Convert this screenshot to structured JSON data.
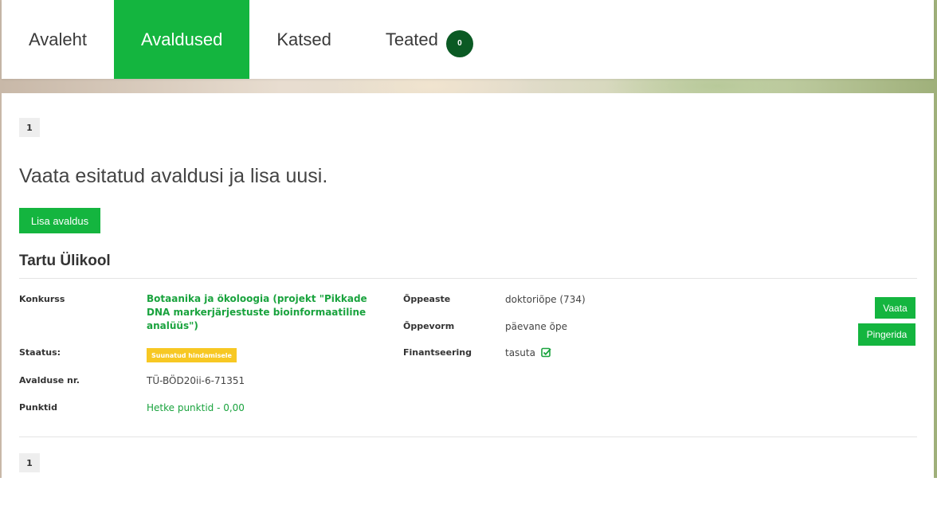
{
  "nav": {
    "items": [
      {
        "label": "Avaleht",
        "active": false
      },
      {
        "label": "Avaldused",
        "active": true
      },
      {
        "label": "Katsed",
        "active": false
      },
      {
        "label": "Teated",
        "active": false
      }
    ],
    "notifications_count": "0"
  },
  "pagination": {
    "top_page": "1",
    "bottom_page": "1"
  },
  "main": {
    "heading": "Vaata esitatud avaldusi ja lisa uusi.",
    "add_button": "Lisa avaldus",
    "school": "Tartu Ülikool"
  },
  "application": {
    "contest_label": "Konkurss",
    "contest_value": "Botaanika ja ökoloogia (projekt \"Pikkade DNA markerjärjestuste bioinformaatiline analüüs\")",
    "status_label": "Staatus:",
    "status_value": "Suunatud hindamisele",
    "number_label": "Avalduse nr.",
    "number_value": "TÜ-BÖD20ii-6-71351",
    "points_label": "Punktid",
    "points_value": "Hetke punktid - 0,00",
    "level_label": "Õppeaste",
    "level_value": "doktoriõpe (734)",
    "form_label": "Õppevorm",
    "form_value": "päevane õpe",
    "funding_label": "Finantseering",
    "funding_value": "tasuta",
    "view_button": "Vaata",
    "ranking_button": "Pingerida"
  },
  "icons": {
    "funding_status": "check-square-icon"
  },
  "colors": {
    "accent": "#14b53f",
    "badge_dark": "#0b5a24",
    "status_warning": "#f7c823",
    "link_green": "#1aa33e"
  }
}
